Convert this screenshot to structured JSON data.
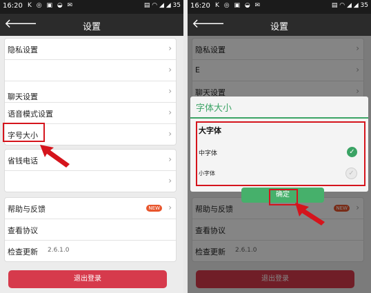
{
  "left": {
    "status": {
      "time": "16:20",
      "icons": "K ◎ ▣ ◒ ✉",
      "right_icons": "▤ ◠ ◢ ◢ 35"
    },
    "title": "设置",
    "group1": [
      {
        "label": "隐私设置"
      },
      {
        "label": ""
      },
      {
        "label": "聊天设置"
      },
      {
        "label": "语音模式设置"
      },
      {
        "label": "字号大小"
      }
    ],
    "group2": [
      {
        "label": "省钱电话"
      },
      {
        "label": ""
      }
    ],
    "group3": [
      {
        "label": "帮助与反馈",
        "badge": "NEW"
      },
      {
        "label": "查看协议"
      },
      {
        "label": "检查更新",
        "value": "2.6.1.0"
      }
    ],
    "logout": "退出登录"
  },
  "right": {
    "status": {
      "time": "16:20",
      "icons": "K ◎ ▣ ◒ ✉",
      "right_icons": "▤ ◠ ◢ ◢ 35"
    },
    "title": "设置",
    "group1": [
      {
        "label": "隐私设置"
      },
      {
        "label": "E"
      },
      {
        "label": "聊天设置"
      }
    ],
    "group3": [
      {
        "label": "帮助与反馈",
        "badge": "NEW"
      },
      {
        "label": "查看协议"
      },
      {
        "label": "检查更新",
        "value": "2.6.1.0"
      }
    ],
    "logout": "退出登录",
    "dialog": {
      "title": "字体大小",
      "options": [
        {
          "label": "大字体",
          "selected": false
        },
        {
          "label": "中字体",
          "selected": true
        },
        {
          "label": "小字体",
          "selected": false
        }
      ],
      "ok": "确定"
    }
  },
  "colors": {
    "accent": "#3aa364",
    "logout": "#d63a4c",
    "highlight": "#d5141c"
  },
  "icons": {
    "back": "back-arrow-icon",
    "chevron": "chevron-right-icon",
    "check": "check-circle-icon"
  }
}
